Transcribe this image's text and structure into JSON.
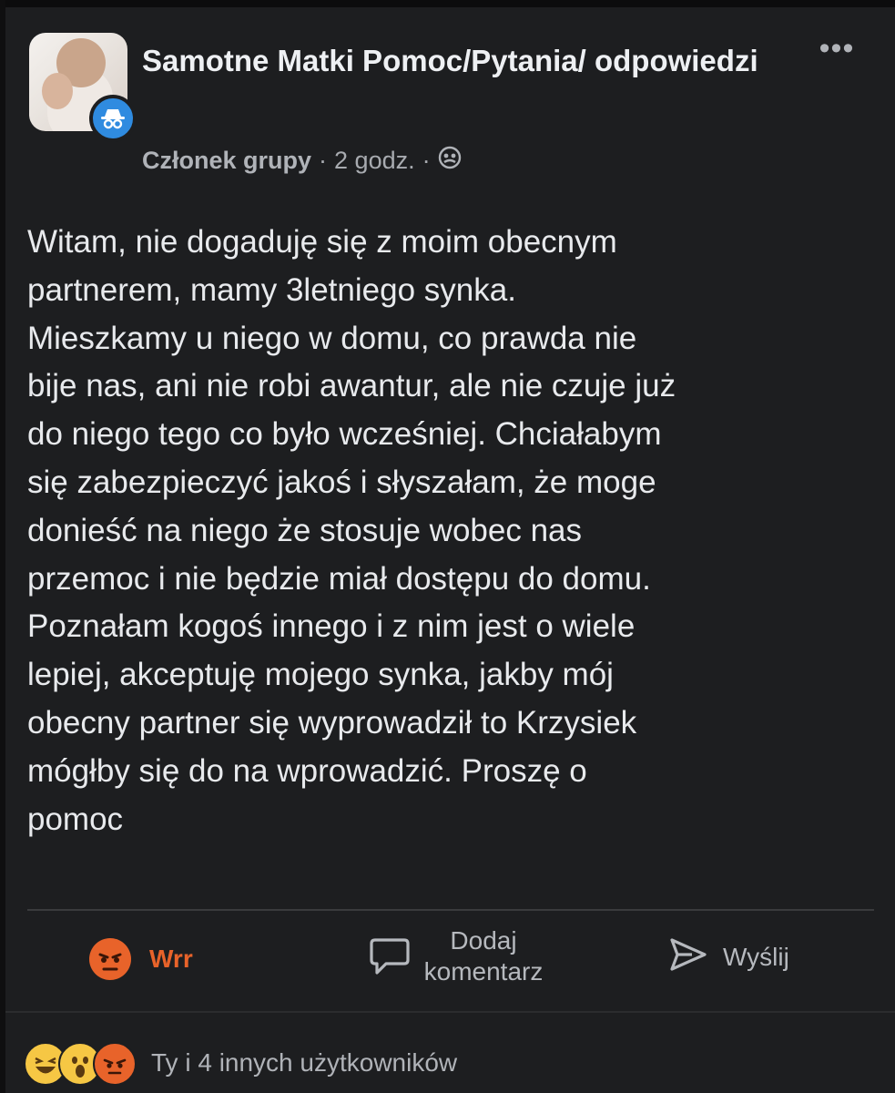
{
  "post": {
    "group_name": "Samotne Matki Pomoc/Pytania/ odpowiedzi",
    "role": "Członek grupy",
    "time": "2 godz.",
    "more_label": "•••",
    "body": "Witam, nie dogaduję się z moim obecnym\npartnerem, mamy 3letniego synka.\nMieszkamy u niego w domu, co prawda nie\nbije nas, ani nie robi awantur, ale nie czuje już\ndo niego tego co było wcześniej. Chciałabym\nsię zabezpieczyć jakoś i słyszałam, że moge\ndonieść na niego że stosuje wobec nas\nprzemoc i nie będzie miał dostępu do domu.\nPoznałam kogoś innego i z nim jest o wiele\nlepiej, akceptuję mojego synka, jakby mój\nobecny partner się wyprowadził to Krzysiek\nmógłby się do na wprowadzić. Proszę o\npomoc"
  },
  "actions": {
    "react_label": "Wrr",
    "comment_label": "Dodaj komentarz",
    "send_label": "Wyślij"
  },
  "footer": {
    "reactions_text": "Ty i 4 innych użytkowników",
    "reaction_icons": [
      "haha-icon",
      "wow-icon",
      "angry-icon"
    ]
  },
  "colors": {
    "background": "#1d1e20",
    "text": "#e8eaed",
    "muted": "#b0b3b8",
    "angry": "#e8632a",
    "badge": "#2f8be0"
  }
}
